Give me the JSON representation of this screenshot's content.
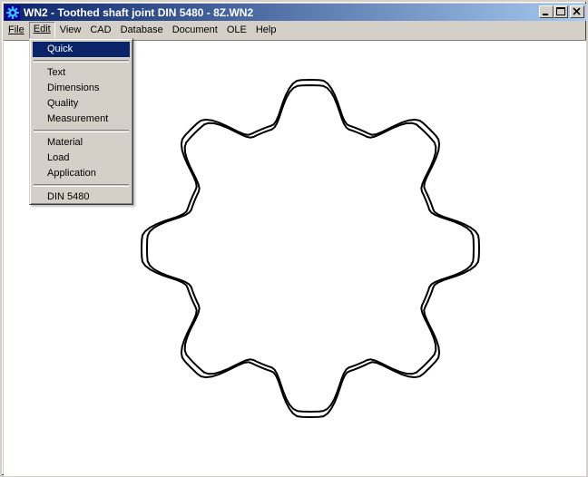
{
  "window": {
    "title": "WN2 - Toothed shaft joint DIN 5480  -  8Z.WN2",
    "icon": "gear-app-icon"
  },
  "menubar": {
    "items": [
      {
        "label": "File",
        "key": "F"
      },
      {
        "label": "Edit",
        "key": "E",
        "active": true
      },
      {
        "label": "View",
        "key": "V"
      },
      {
        "label": "CAD",
        "key": "C"
      },
      {
        "label": "Database",
        "key": "D"
      },
      {
        "label": "Document",
        "key": "o"
      },
      {
        "label": "OLE",
        "key": "O"
      },
      {
        "label": "Help",
        "key": "H"
      }
    ]
  },
  "edit_menu": {
    "groups": [
      [
        {
          "label": "Quick",
          "highlighted": true
        }
      ],
      [
        {
          "label": "Text"
        },
        {
          "label": "Dimensions"
        },
        {
          "label": "Quality"
        },
        {
          "label": "Measurement"
        }
      ],
      [
        {
          "label": "Material"
        },
        {
          "label": "Load"
        },
        {
          "label": "Application"
        }
      ],
      [
        {
          "label": "DIN 5480"
        }
      ]
    ]
  },
  "drawing": {
    "teeth": 8,
    "stroke_color": "#000000"
  },
  "colors": {
    "title_start": "#0a246a",
    "title_end": "#a6caf0",
    "menu_highlight": "#0a246a",
    "face": "#d4d0c8"
  }
}
